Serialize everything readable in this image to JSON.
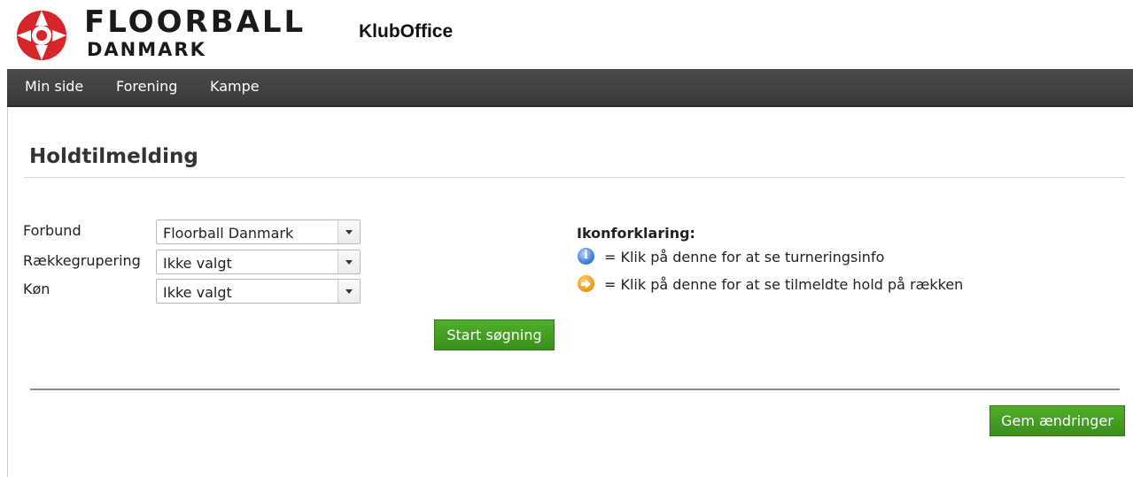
{
  "header": {
    "logo_line1": "FLOORBALL",
    "logo_line2": "DANMARK",
    "app_title": "KlubOffice"
  },
  "nav": {
    "items": [
      {
        "label": "Min side"
      },
      {
        "label": "Forening"
      },
      {
        "label": "Kampe"
      }
    ]
  },
  "page": {
    "title": "Holdtilmelding"
  },
  "form": {
    "fields": [
      {
        "label": "Forbund",
        "value": "Floorball Danmark"
      },
      {
        "label": "Rækkegrupering",
        "value": "Ikke valgt"
      },
      {
        "label": "Køn",
        "value": "Ikke valgt"
      }
    ],
    "search_button": "Start søgning"
  },
  "legend": {
    "title": "Ikonforklaring:",
    "items": [
      {
        "icon": "info-icon",
        "text": "= Klik på denne for at se turneringsinfo"
      },
      {
        "icon": "arrow-right-icon",
        "text": "= Klik på denne for at se tilmeldte hold på rækken"
      }
    ]
  },
  "footer": {
    "save_button": "Gem ændringer"
  },
  "colors": {
    "nav_bg": "#3f3f3f",
    "button_green": "#45a222",
    "logo_red": "#d6262b"
  }
}
